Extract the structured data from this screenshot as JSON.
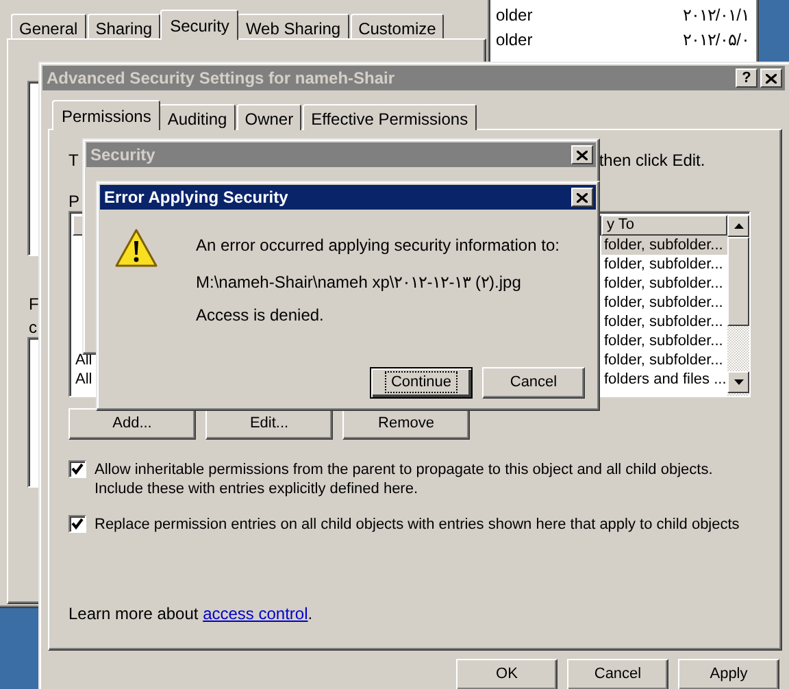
{
  "properties_window": {
    "tabs": [
      {
        "label": "General",
        "selected": false
      },
      {
        "label": "Sharing",
        "selected": false
      },
      {
        "label": "Security",
        "selected": true
      },
      {
        "label": "Web Sharing",
        "selected": false
      },
      {
        "label": "Customize",
        "selected": false
      }
    ],
    "fragments": [
      "F",
      "c"
    ]
  },
  "explorer_list": {
    "rows": [
      {
        "type": "older",
        "date": "۲۰۱۲/۰۱/۱"
      },
      {
        "type": "older",
        "date": "۲۰۱۲/۰۵/۰"
      }
    ]
  },
  "advanced_window": {
    "title": "Advanced Security Settings for nameh-Shair",
    "help_button": "?",
    "tabs": [
      {
        "label": "Permissions",
        "selected": true
      },
      {
        "label": "Auditing",
        "selected": false
      },
      {
        "label": "Owner",
        "selected": false
      },
      {
        "label": "Effective Permissions",
        "selected": false
      }
    ],
    "instruction_start": "T",
    "instruction_end": "then click Edit.",
    "list_label_start": "P",
    "list": {
      "column_header": "y To",
      "rows": [
        {
          "name": "",
          "apply_to": "folder, subfolder...",
          "selected": true
        },
        {
          "name": "",
          "apply_to": "folder, subfolder...",
          "selected": false
        },
        {
          "name": "",
          "apply_to": "folder, subfolder...",
          "selected": false
        },
        {
          "name": "",
          "apply_to": "folder, subfolder...",
          "selected": false
        },
        {
          "name": "",
          "apply_to": "folder, subfolder...",
          "selected": false
        },
        {
          "name": "",
          "apply_to": "folder, subfolder...",
          "selected": false
        },
        {
          "name": "All",
          "apply_to": "folder, subfolder...",
          "selected": false
        },
        {
          "name": "All",
          "apply_to": "folders and files ...",
          "selected": false
        }
      ]
    },
    "buttons": [
      "Add...",
      "Edit...",
      "Remove"
    ],
    "options": [
      {
        "label": "Allow inheritable permissions from the parent to propagate to this object and all child objects. Include these with entries explicitly defined here.",
        "checked": true
      },
      {
        "label": "Replace permission entries on all child objects with entries shown here that apply to child objects",
        "checked": true
      }
    ],
    "learn_more": {
      "text": "Learn more about",
      "link": "access control",
      "tail": "."
    },
    "footer_buttons": [
      "OK",
      "Cancel",
      "Apply"
    ]
  },
  "security_dialog": {
    "title": "Security"
  },
  "error_dialog": {
    "title": "Error Applying Security",
    "message": "An error occurred applying security information to:",
    "path": "M:\\nameh-Shair\\nameh xp\\۲۰۱۲-۱۲-۱۳ (۲).jpg",
    "detail": "Access is denied.",
    "buttons": [
      {
        "label": "Continue",
        "default": true
      },
      {
        "label": "Cancel",
        "default": false
      }
    ]
  }
}
